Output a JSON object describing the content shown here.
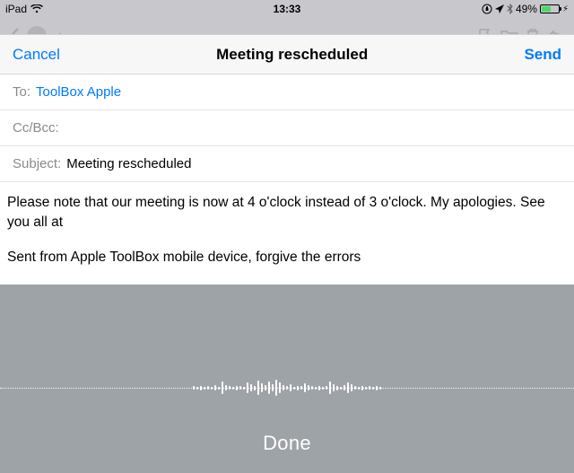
{
  "status": {
    "device": "iPad",
    "time": "13:33",
    "battery_pct": "49%"
  },
  "compose": {
    "cancel": "Cancel",
    "send": "Send",
    "title": "Meeting rescheduled",
    "to_label": "To:",
    "to_value": "ToolBox Apple",
    "ccbcc_label": "Cc/Bcc:",
    "subject_label": "Subject:",
    "subject_value": "Meeting rescheduled",
    "body_line1": "Please note that our meeting is now at 4 o'clock instead of 3 o'clock. My apologies. See you all at",
    "signature": "Sent from Apple ToolBox mobile device, forgive the errors"
  },
  "dictation": {
    "done": "Done"
  }
}
